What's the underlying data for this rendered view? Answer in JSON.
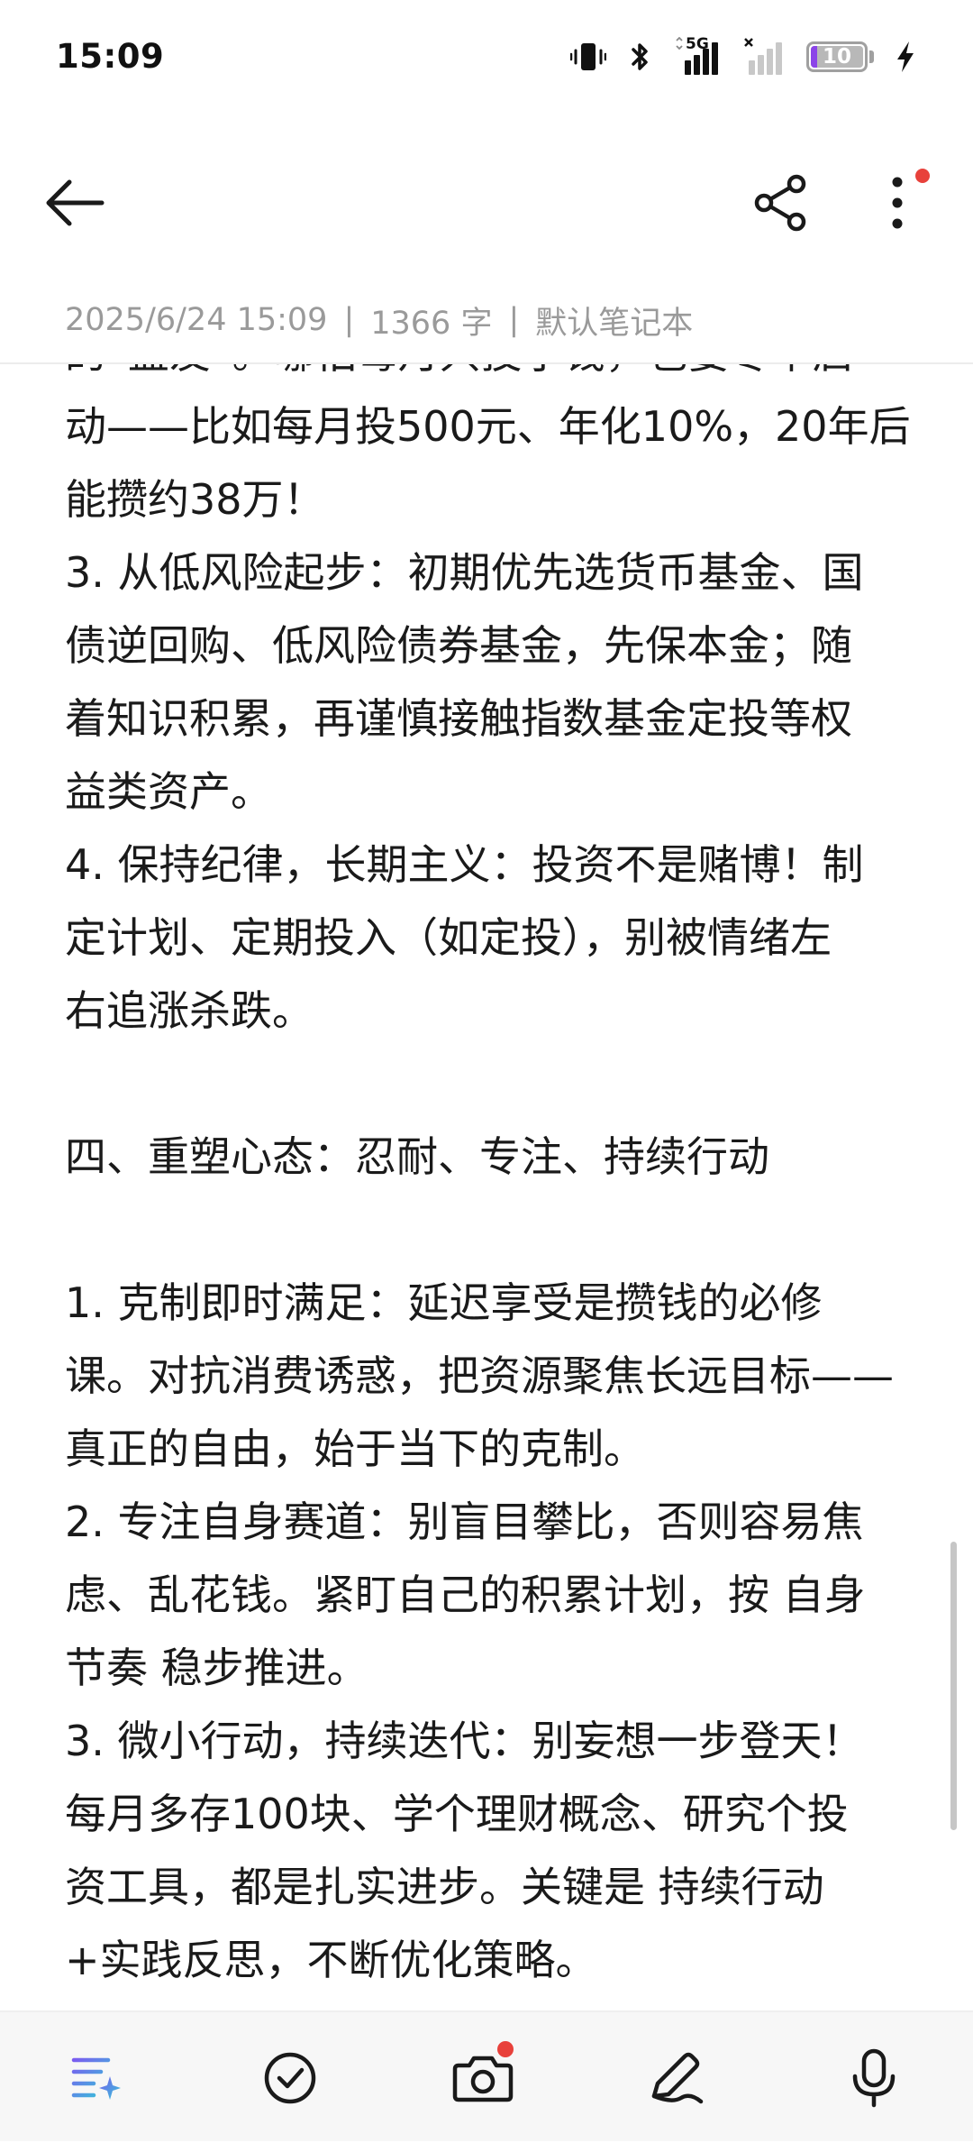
{
  "status_bar": {
    "time": "15:09",
    "network": "5G",
    "battery_level": "10",
    "icons": [
      "vibrate-icon",
      "bluetooth-icon",
      "signal-5g-icon",
      "signal-no-sim-icon",
      "battery-icon",
      "charging-icon"
    ]
  },
  "toolbar": {
    "back_icon": "arrow-left-icon",
    "share_icon": "share-icon",
    "more_icon": "more-vertical-icon",
    "notification_color": "#e8413b"
  },
  "note_meta": {
    "datetime": "2025/6/24 15:09",
    "separator": "|",
    "char_count": "1366 字",
    "notebook": "默认笔记本"
  },
  "note_body": {
    "lines": [
      "的“益友”。哪怕每月只投小钱，也要尽早启",
      "动——比如每月投500元、年化10%，20年后",
      "能攒约38万！",
      "3. 从低风险起步：初期优先选货币基金、国",
      "债逆回购、低风险债券基金，先保本金；随",
      "着知识积累，再谨慎接触指数基金定投等权",
      "益类资产。",
      "4. 保持纪律，长期主义：投资不是赌博！制",
      "定计划、定期投入（如定投），别被情绪左",
      "右追涨杀跌。",
      "",
      "四、重塑心态：忍耐、专注、持续行动",
      "",
      "1. 克制即时满足：延迟享受是攒钱的必修",
      "课。对抗消费诱惑，把资源聚焦长远目标——",
      "真正的自由，始于当下的克制。",
      "2. 专注自身赛道：别盲目攀比，否则容易焦",
      "虑、乱花钱。紧盯自己的积累计划，按 自身",
      "节奏 稳步推进。",
      "3. 微小行动，持续迭代：别妄想一步登天！",
      "每月多存100块、学个理财概念、研究个投",
      "资工具，都是扎实进步。关键是 持续行动",
      "+实践反思，不断优化策略。"
    ]
  },
  "bottom_toolbar": {
    "items": [
      {
        "icon": "ai-format-icon",
        "name": "format-button"
      },
      {
        "icon": "checklist-icon",
        "name": "checklist-button"
      },
      {
        "icon": "camera-icon",
        "name": "camera-button"
      },
      {
        "icon": "handwriting-icon",
        "name": "handwriting-button"
      },
      {
        "icon": "microphone-icon",
        "name": "voice-button"
      }
    ]
  },
  "colors": {
    "accent_purple": "#8b45e8",
    "notification_red": "#e8413b",
    "meta_gray": "#9a9a9a"
  }
}
